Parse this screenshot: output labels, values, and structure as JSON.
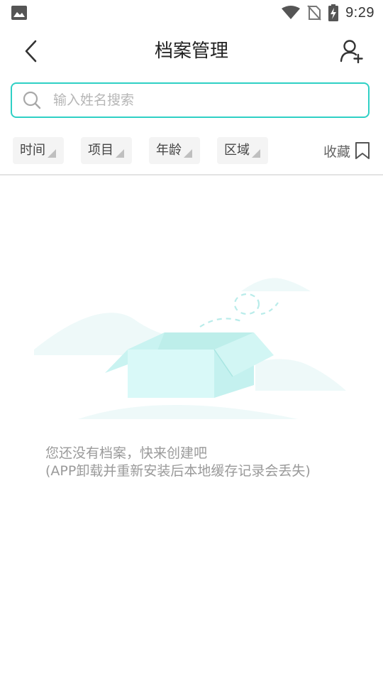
{
  "status_bar": {
    "time": "9:29",
    "icons": [
      "image-icon",
      "wifi-icon",
      "no-sim-icon",
      "battery-charging-icon"
    ]
  },
  "header": {
    "title": "档案管理",
    "back_icon": "chevron-left-icon",
    "add_user_icon": "add-user-icon"
  },
  "search": {
    "placeholder": "输入姓名搜索",
    "value": "",
    "icon": "search-icon",
    "border_color": "#2fd0c5"
  },
  "filters": [
    {
      "label": "时间"
    },
    {
      "label": "项目"
    },
    {
      "label": "年龄"
    },
    {
      "label": "区域"
    }
  ],
  "favorite": {
    "label": "收藏",
    "icon": "bookmark-icon"
  },
  "empty_state": {
    "line1": "您还没有档案，快来创建吧",
    "line2": "(APP卸载并重新安装后本地缓存记录会丢失)",
    "illustration": "open-box-icon"
  },
  "colors": {
    "accent": "#2fd0c5",
    "illustration_light": "#e8fafa",
    "illustration_box": "#c9f3f1"
  }
}
